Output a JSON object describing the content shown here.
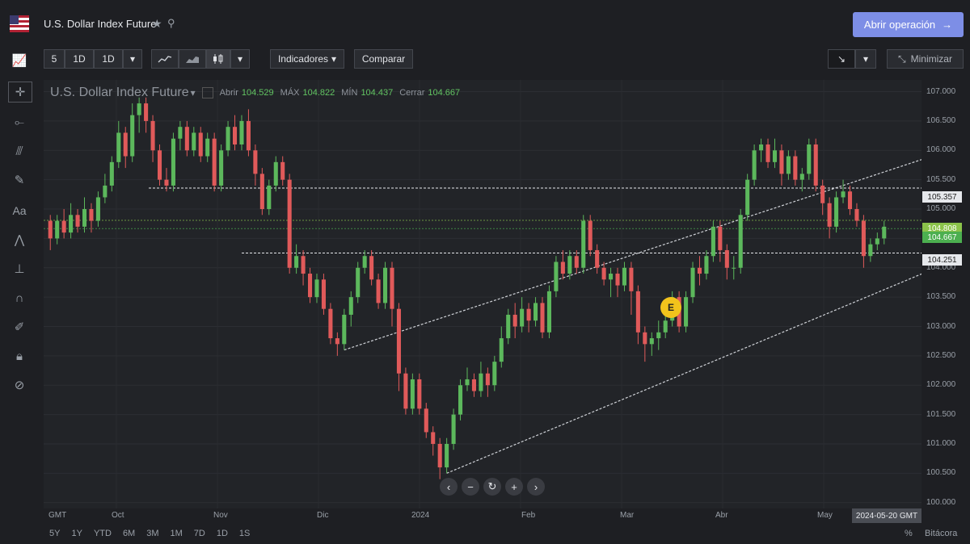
{
  "header": {
    "title": "U.S. Dollar Index Future",
    "open_button": "Abrir operación",
    "open_button_icon": "arrow-right-icon"
  },
  "toolbar": {
    "interval_5": "5",
    "interval_1d": "1D",
    "period_1d": "1D",
    "indicators": "Indicadores",
    "compare": "Comparar",
    "minimize": "Minimizar"
  },
  "legend": {
    "name": "U.S. Dollar Index Future",
    "open_label": "Abrir",
    "open_value": "104.529",
    "high_label": "MÁX",
    "high_value": "104.822",
    "low_label": "MÍN",
    "low_value": "104.437",
    "close_label": "Cerrar",
    "close_value": "104.667"
  },
  "yaxis": {
    "ticks": [
      "107.000",
      "106.500",
      "106.000",
      "105.500",
      "105.000",
      "104.500",
      "104.000",
      "103.500",
      "103.000",
      "102.500",
      "102.000",
      "101.500",
      "101.000",
      "100.500",
      "100.000"
    ],
    "tags": {
      "line_upper": "105.357",
      "high": "104.808",
      "close": "104.667",
      "line_lower": "104.251"
    }
  },
  "xaxis": {
    "tz": "GMT",
    "labels": [
      "Oct",
      "Nov",
      "Dic",
      "2024",
      "Feb",
      "Mar",
      "Abr",
      "May"
    ],
    "current_date": "2024-05-20 GMT"
  },
  "ranges": [
    "5Y",
    "1Y",
    "YTD",
    "6M",
    "3M",
    "1M",
    "7D",
    "1D",
    "1S"
  ],
  "footer": {
    "percent": "%",
    "log": "Bitácora"
  },
  "event_badge": "E",
  "colors": {
    "up": "#5cb85c",
    "down": "#e05a5a",
    "accent": "#7d8ee6",
    "badge": "#f2c31c"
  },
  "chart_data": {
    "type": "candlestick",
    "ylim": [
      99.9,
      107.2
    ],
    "hlines": [
      105.357,
      104.251
    ],
    "series": [
      {
        "name": "U.S. Dollar Index Future",
        "values": [
          [
            104.8,
            104.5,
            104.9,
            104.3
          ],
          [
            104.5,
            104.8,
            104.9,
            104.4
          ],
          [
            104.8,
            104.6,
            105.0,
            104.5
          ],
          [
            104.6,
            104.9,
            105.1,
            104.5
          ],
          [
            104.9,
            104.7,
            105.0,
            104.6
          ],
          [
            104.7,
            105.0,
            105.2,
            104.6
          ],
          [
            105.0,
            104.8,
            105.1,
            104.6
          ],
          [
            104.8,
            105.2,
            105.3,
            104.7
          ],
          [
            105.2,
            105.4,
            105.6,
            105.1
          ],
          [
            105.4,
            105.8,
            105.9,
            105.3
          ],
          [
            105.8,
            106.3,
            106.5,
            105.7
          ],
          [
            106.3,
            105.9,
            106.4,
            105.7
          ],
          [
            105.9,
            106.6,
            106.8,
            105.8
          ],
          [
            106.6,
            106.8,
            106.9,
            106.3
          ],
          [
            106.8,
            106.5,
            106.9,
            106.3
          ],
          [
            106.5,
            106.0,
            106.6,
            105.8
          ],
          [
            106.0,
            105.5,
            106.1,
            105.4
          ],
          [
            105.5,
            105.4,
            105.7,
            105.3
          ],
          [
            105.4,
            106.2,
            106.3,
            105.3
          ],
          [
            106.2,
            106.4,
            106.5,
            106.0
          ],
          [
            106.4,
            106.0,
            106.5,
            105.9
          ],
          [
            106.0,
            106.3,
            106.4,
            105.9
          ],
          [
            106.3,
            105.9,
            106.4,
            105.8
          ],
          [
            105.9,
            106.2,
            106.3,
            105.8
          ],
          [
            106.2,
            105.4,
            106.3,
            105.3
          ],
          [
            105.4,
            106.0,
            106.1,
            105.3
          ],
          [
            106.0,
            106.4,
            106.5,
            105.9
          ],
          [
            106.4,
            106.1,
            106.6,
            106.0
          ],
          [
            106.1,
            106.5,
            106.6,
            106.0
          ],
          [
            106.5,
            106.0,
            106.7,
            105.9
          ],
          [
            106.0,
            105.6,
            106.1,
            105.4
          ],
          [
            105.6,
            105.0,
            105.7,
            104.9
          ],
          [
            105.0,
            105.4,
            105.5,
            104.9
          ],
          [
            105.4,
            105.8,
            105.9,
            105.3
          ],
          [
            105.8,
            105.5,
            105.9,
            105.4
          ],
          [
            105.5,
            104.0,
            105.6,
            103.9
          ],
          [
            104.0,
            104.2,
            104.4,
            103.9
          ],
          [
            104.2,
            103.9,
            104.3,
            103.7
          ],
          [
            103.9,
            103.5,
            104.0,
            103.4
          ],
          [
            103.5,
            103.8,
            103.9,
            103.4
          ],
          [
            103.8,
            103.3,
            103.9,
            103.2
          ],
          [
            103.3,
            102.8,
            103.4,
            102.7
          ],
          [
            102.8,
            102.7,
            102.9,
            102.5
          ],
          [
            102.7,
            103.2,
            103.3,
            102.6
          ],
          [
            103.2,
            103.5,
            103.6,
            103.0
          ],
          [
            103.5,
            104.0,
            104.1,
            103.4
          ],
          [
            104.0,
            104.2,
            104.3,
            103.9
          ],
          [
            104.2,
            103.8,
            104.3,
            103.7
          ],
          [
            103.8,
            103.4,
            103.9,
            103.3
          ],
          [
            103.4,
            104.0,
            104.1,
            103.3
          ],
          [
            104.0,
            103.3,
            104.1,
            103.0
          ],
          [
            103.3,
            102.2,
            103.4,
            101.9
          ],
          [
            102.2,
            101.6,
            102.3,
            101.5
          ],
          [
            101.6,
            102.1,
            102.2,
            101.5
          ],
          [
            102.1,
            101.6,
            102.2,
            101.5
          ],
          [
            101.6,
            101.2,
            101.7,
            101.1
          ],
          [
            101.2,
            101.0,
            101.3,
            100.8
          ],
          [
            101.0,
            100.6,
            101.1,
            100.4
          ],
          [
            100.6,
            101.0,
            101.1,
            100.5
          ],
          [
            101.0,
            101.5,
            101.6,
            100.9
          ],
          [
            101.5,
            102.0,
            102.1,
            101.4
          ],
          [
            102.0,
            102.1,
            102.3,
            101.9
          ],
          [
            102.1,
            101.9,
            102.2,
            101.8
          ],
          [
            101.9,
            102.2,
            102.4,
            101.8
          ],
          [
            102.2,
            102.0,
            102.3,
            101.8
          ],
          [
            102.0,
            102.4,
            102.5,
            101.9
          ],
          [
            102.4,
            102.8,
            103.0,
            102.3
          ],
          [
            102.8,
            103.2,
            103.3,
            102.7
          ],
          [
            103.2,
            103.0,
            103.4,
            102.8
          ],
          [
            103.0,
            103.3,
            103.5,
            102.9
          ],
          [
            103.3,
            103.1,
            103.4,
            102.9
          ],
          [
            103.1,
            103.4,
            103.5,
            103.0
          ],
          [
            103.4,
            102.9,
            103.5,
            102.8
          ],
          [
            102.9,
            103.6,
            103.7,
            102.8
          ],
          [
            103.6,
            104.1,
            104.2,
            103.5
          ],
          [
            104.1,
            103.9,
            104.3,
            103.8
          ],
          [
            103.9,
            104.2,
            104.3,
            103.8
          ],
          [
            104.2,
            104.0,
            104.3,
            103.9
          ],
          [
            104.0,
            104.8,
            104.9,
            103.9
          ],
          [
            104.8,
            104.3,
            104.9,
            104.2
          ],
          [
            104.3,
            104.0,
            104.4,
            103.9
          ],
          [
            104.0,
            103.8,
            104.1,
            103.7
          ],
          [
            103.8,
            103.9,
            104.0,
            103.5
          ],
          [
            103.9,
            103.7,
            104.0,
            103.5
          ],
          [
            103.7,
            104.0,
            104.1,
            103.6
          ],
          [
            104.0,
            103.6,
            104.1,
            103.2
          ],
          [
            103.6,
            102.9,
            103.7,
            102.7
          ],
          [
            102.9,
            102.7,
            103.0,
            102.4
          ],
          [
            102.7,
            102.8,
            102.9,
            102.5
          ],
          [
            102.8,
            102.9,
            103.1,
            102.6
          ],
          [
            102.9,
            103.1,
            103.2,
            102.8
          ],
          [
            103.1,
            103.5,
            103.6,
            103.0
          ],
          [
            103.5,
            103.0,
            103.6,
            102.9
          ],
          [
            103.0,
            103.5,
            103.6,
            102.9
          ],
          [
            103.5,
            104.0,
            104.1,
            103.4
          ],
          [
            104.0,
            103.9,
            104.2,
            103.7
          ],
          [
            103.9,
            104.2,
            104.3,
            103.8
          ],
          [
            104.2,
            104.7,
            104.8,
            104.1
          ],
          [
            104.7,
            104.3,
            104.8,
            104.1
          ],
          [
            104.3,
            104.0,
            104.4,
            103.8
          ],
          [
            104.0,
            104.0,
            104.2,
            103.8
          ],
          [
            104.0,
            104.9,
            105.0,
            103.9
          ],
          [
            104.9,
            105.5,
            105.6,
            104.8
          ],
          [
            105.5,
            106.0,
            106.1,
            105.4
          ],
          [
            106.0,
            106.1,
            106.2,
            105.8
          ],
          [
            106.1,
            105.8,
            106.2,
            105.7
          ],
          [
            105.8,
            106.0,
            106.2,
            105.7
          ],
          [
            106.0,
            105.6,
            106.1,
            105.4
          ],
          [
            105.6,
            105.9,
            106.0,
            105.5
          ],
          [
            105.9,
            105.5,
            106.0,
            105.4
          ],
          [
            105.5,
            105.6,
            105.7,
            105.3
          ],
          [
            105.6,
            106.1,
            106.2,
            105.5
          ],
          [
            106.1,
            105.4,
            106.2,
            105.3
          ],
          [
            105.4,
            105.1,
            105.5,
            104.9
          ],
          [
            105.1,
            104.7,
            105.2,
            104.5
          ],
          [
            104.7,
            105.2,
            105.3,
            104.6
          ],
          [
            105.2,
            105.3,
            105.5,
            105.1
          ],
          [
            105.3,
            105.0,
            105.4,
            104.9
          ],
          [
            105.0,
            104.8,
            105.1,
            104.7
          ],
          [
            104.8,
            104.2,
            104.9,
            104.0
          ],
          [
            104.2,
            104.4,
            104.5,
            104.1
          ],
          [
            104.4,
            104.5,
            104.6,
            104.3
          ],
          [
            104.5,
            104.7,
            104.8,
            104.4
          ]
        ]
      }
    ],
    "channels": [
      {
        "from": [
          43,
          102.6
        ],
        "to": [
          142,
          106.4
        ]
      },
      {
        "from": [
          58,
          100.5
        ],
        "to": [
          146,
          104.8
        ]
      }
    ]
  }
}
